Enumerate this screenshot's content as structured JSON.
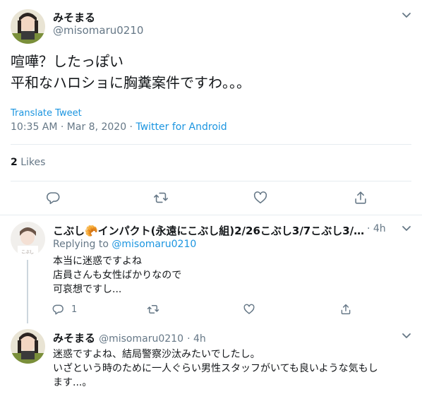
{
  "main_tweet": {
    "display_name": "みそまる",
    "handle": "@misomaru0210",
    "lines": [
      "喧嘩？したっぽい",
      "平和なハロショに胸糞案件ですわ。。。"
    ],
    "translate": "Translate Tweet",
    "time": "10:35 AM · Mar 8, 2020 · ",
    "client": "Twitter for Android",
    "likes_count": "2",
    "likes_label": " Likes"
  },
  "reply_1": {
    "display_name": "こぶし🥐インパクト(永遠にこぶし組)2/26こぶし3/7こぶし3/…",
    "age": "· 4h",
    "replying_prefix": "Replying to ",
    "replying_to": "@misomaru0210",
    "lines": [
      "本当に迷惑ですよね",
      "店員さんも女性ばかりなので",
      "可哀想ですし..."
    ],
    "reply_count": "1",
    "avatar_label": "こぶし"
  },
  "reply_2": {
    "display_name": "みそまる",
    "handle": "@misomaru0210",
    "age": "· 4h",
    "lines": [
      "迷惑ですよね、結局警察沙汰みたいでしたし。",
      "いざという時のために一人ぐらい男性スタッフがいても良いような気もし",
      "ます...。"
    ]
  },
  "colors": {
    "text": "#14171a",
    "secondary": "#657786",
    "link": "#1b95e0",
    "divider": "#e6ecf0",
    "thread": "#ccd6dd"
  },
  "icons": [
    "chevron-down-icon",
    "reply-icon",
    "retweet-icon",
    "like-icon",
    "share-icon"
  ]
}
